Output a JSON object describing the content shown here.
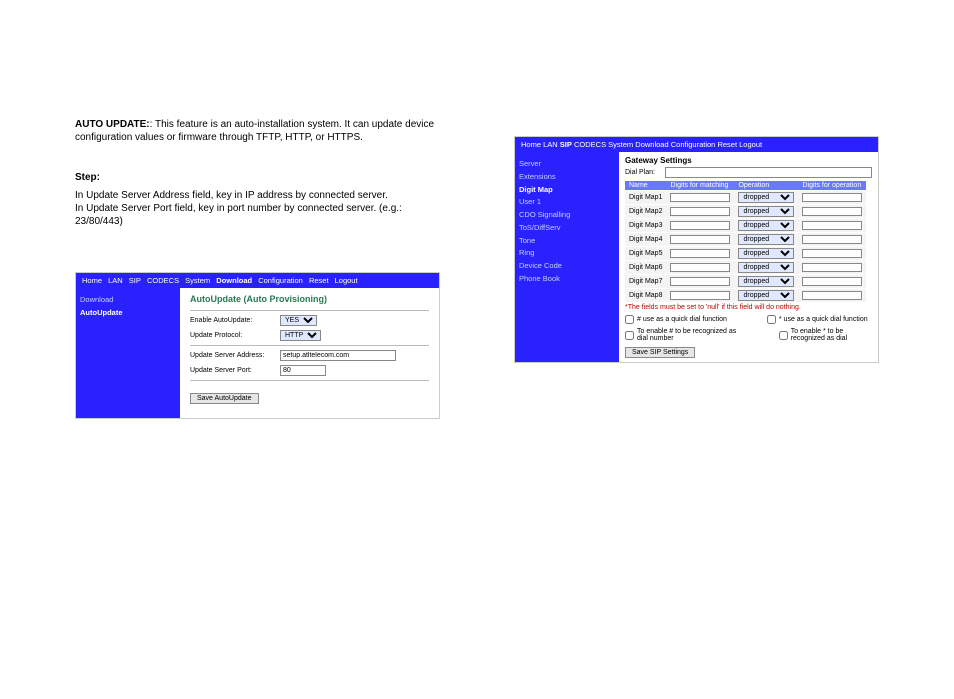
{
  "feature": {
    "label": "AUTO UPDATE:",
    "text": ": This feature is an auto-installation system. It can update device configuration values or firmware through TFTP, HTTP, or HTTPS."
  },
  "step_heading": "Step:",
  "step_desc1": "In Update Server Address field, key in IP address by connected server.",
  "step_desc2": "In Update Server Port field, key in port number by connected server.  (e.g.: 23/80/443)",
  "panel1": {
    "nav": [
      "Home",
      "LAN",
      "SIP",
      "CODECS",
      "System",
      "Download",
      "Configuration",
      "Reset",
      "Logout"
    ],
    "nav_active": "Download",
    "sidebar": [
      {
        "label": "Download",
        "selected": false
      },
      {
        "label": "AutoUpdate",
        "selected": true
      }
    ],
    "title": "AutoUpdate (Auto Provisioning)",
    "enable_label": "Enable AutoUpdate:",
    "enable_value": "YES",
    "protocol_label": "Update Protocol:",
    "protocol_value": "HTTP",
    "server_addr_label": "Update Server Address:",
    "server_addr_value": "setup.atltelecom.com",
    "server_port_label": "Update Server Port:",
    "server_port_value": "80",
    "btn": "Save AutoUpdate"
  },
  "panel2": {
    "nav": [
      "Home",
      "LAN",
      "SIP",
      "CODECS",
      "System",
      "Download",
      "Configuration",
      "Reset",
      "Logout"
    ],
    "nav_active": "SIP",
    "sidebar": [
      {
        "label": "Server",
        "selected": false
      },
      {
        "label": "Extensions",
        "selected": false
      },
      {
        "label": "Digit Map",
        "selected": true
      },
      {
        "label": "User 1",
        "selected": false
      },
      {
        "label": "CDO Signalling",
        "selected": false
      },
      {
        "label": "ToS/DiffServ",
        "selected": false
      },
      {
        "label": "Tone",
        "selected": false
      },
      {
        "label": "Ring",
        "selected": false
      },
      {
        "label": "Device Code",
        "selected": false
      },
      {
        "label": "Phone Book",
        "selected": false
      }
    ],
    "gw_title": "Gateway Settings",
    "dial_label": "Dial Plan:",
    "dial_value": "",
    "cols": [
      "Name",
      "Digits for matching",
      "Operation",
      "Digits for operation"
    ],
    "rows": [
      {
        "name": "Digit Map1",
        "match": "",
        "op": "dropped",
        "digits": ""
      },
      {
        "name": "Digit Map2",
        "match": "",
        "op": "dropped",
        "digits": ""
      },
      {
        "name": "Digit Map3",
        "match": "",
        "op": "dropped",
        "digits": ""
      },
      {
        "name": "Digit Map4",
        "match": "",
        "op": "dropped",
        "digits": ""
      },
      {
        "name": "Digit Map5",
        "match": "",
        "op": "dropped",
        "digits": ""
      },
      {
        "name": "Digit Map6",
        "match": "",
        "op": "dropped",
        "digits": ""
      },
      {
        "name": "Digit Map7",
        "match": "",
        "op": "dropped",
        "digits": ""
      },
      {
        "name": "Digit Map8",
        "match": "",
        "op": "dropped",
        "digits": ""
      }
    ],
    "note": "*The fields must be set to 'null' if this field will do nothing.",
    "check1": "# use as a quick dial function",
    "check2": "* use as a quick dial function",
    "check3": "To enable # to be recognized as dial number",
    "check4": "To enable * to be recognized as dial",
    "btn": "Save SIP Settings"
  }
}
